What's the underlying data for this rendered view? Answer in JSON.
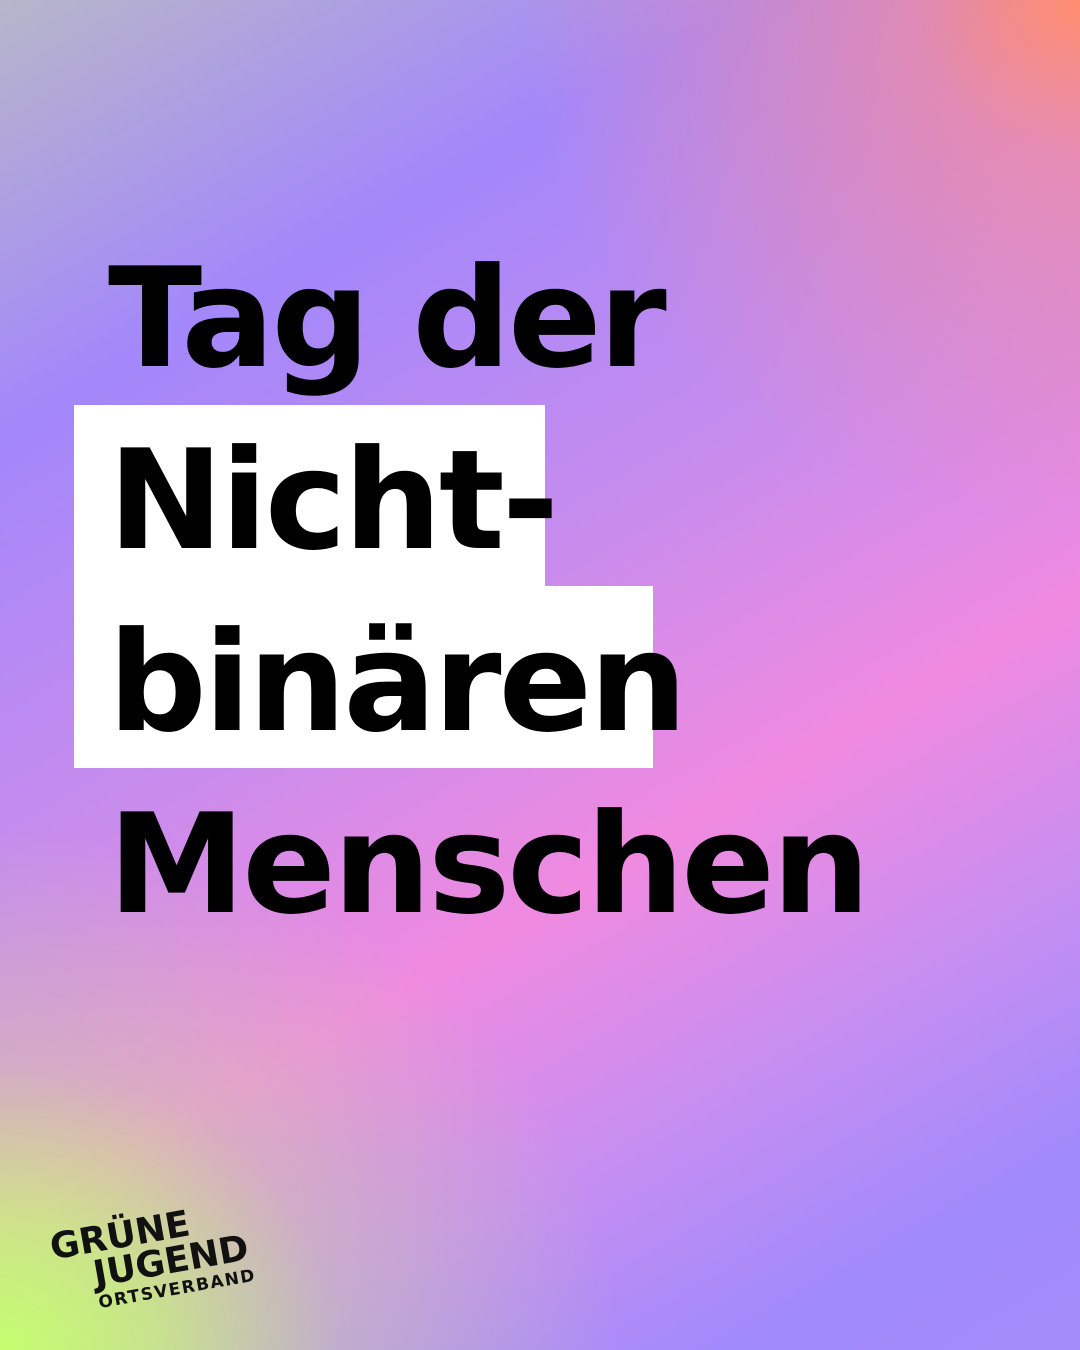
{
  "post": {
    "headline_line1": "Tag der",
    "headline_line2": "Nicht-",
    "headline_line3": "binären",
    "headline_line4": "Menschen"
  },
  "logo": {
    "line1": "GRÜNE",
    "line2": "JUGEND",
    "line3": "ORTSVERBAND"
  },
  "colors": {
    "text": "#000000",
    "highlight": "#ffffff",
    "gradient_green": "#c4ff6e",
    "gradient_purple": "#a387fb",
    "gradient_pink": "#f08ae0",
    "gradient_coral": "#ff8c6e"
  }
}
